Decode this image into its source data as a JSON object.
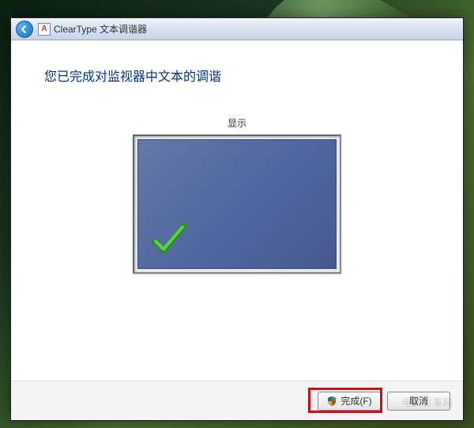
{
  "titlebar": {
    "title": "ClearType 文本调谐器",
    "back_icon": "back-arrow",
    "controls": {
      "minimize": "─",
      "maximize": "□",
      "close": "✕"
    }
  },
  "content": {
    "heading": "您已完成对监视器中文本的调谐",
    "monitor_label": "显示"
  },
  "footer": {
    "finish_label": "完成(F)",
    "cancel_label": "取消"
  },
  "colors": {
    "heading": "#003399",
    "monitor_bg": "#5068a0",
    "check": "#3caa2e"
  }
}
